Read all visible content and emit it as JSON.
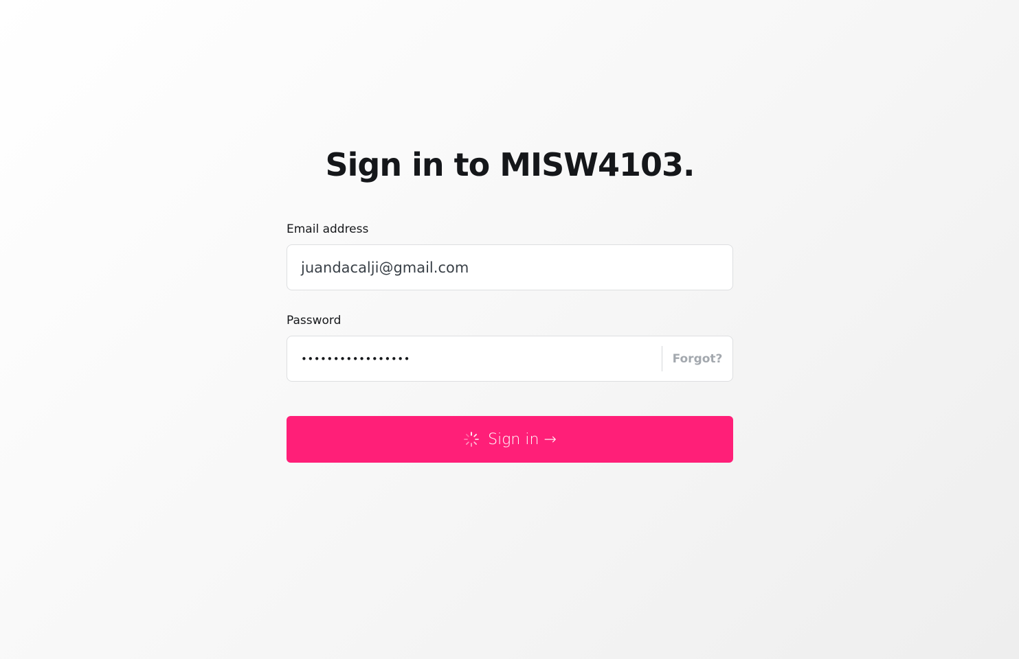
{
  "header": {
    "title": "Sign in to MISW4103."
  },
  "form": {
    "email": {
      "label": "Email address",
      "value": "juandacalji@gmail.com"
    },
    "password": {
      "label": "Password",
      "value": "•••••••••••••••••",
      "forgot_label": "Forgot?"
    },
    "submit": {
      "label": "Sign in →",
      "icon": "spinner-icon",
      "color": "#ff1f78"
    }
  }
}
